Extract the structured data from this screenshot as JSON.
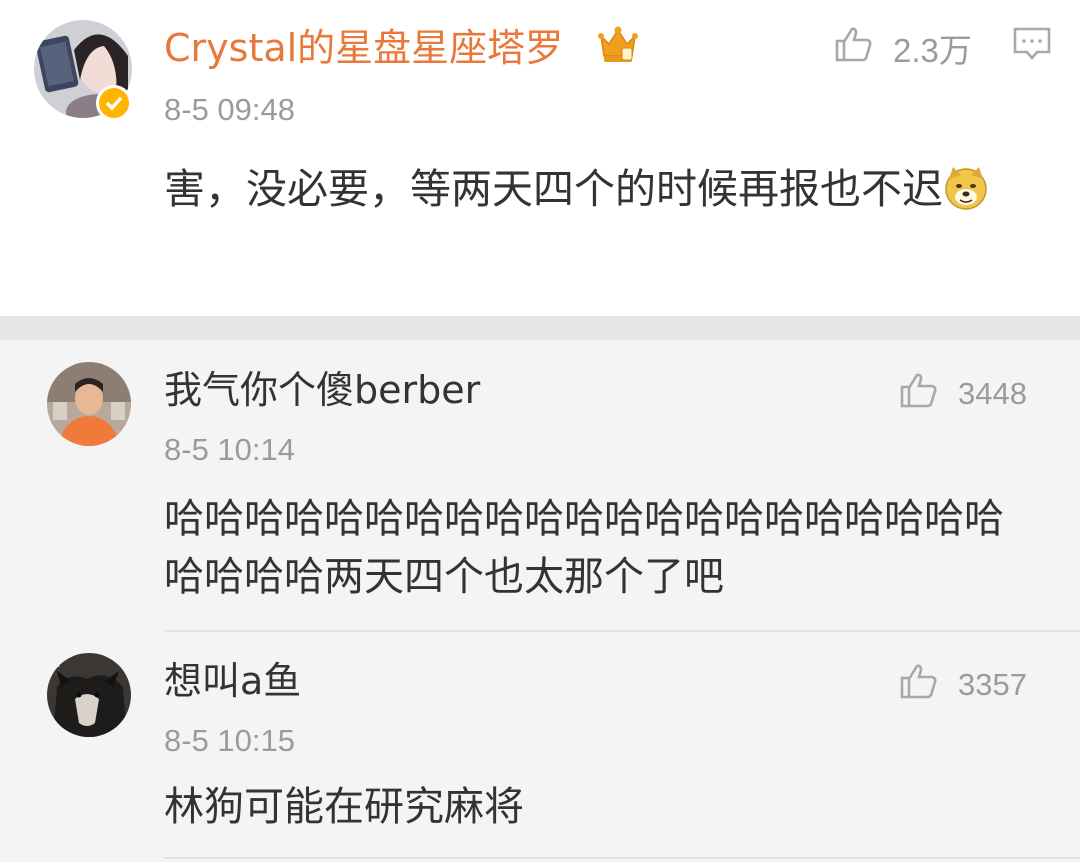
{
  "main_comment": {
    "username": "Crystal的星盘星座塔罗",
    "timestamp": "8-5 09:48",
    "likes": "2.3万",
    "text": "害，没必要，等两天四个的时候再报也不迟",
    "name_color": "#e8793a"
  },
  "replies": [
    {
      "username": "我气你个傻berber",
      "timestamp": "8-5 10:14",
      "likes": "3448",
      "text": "哈哈哈哈哈哈哈哈哈哈哈哈哈哈哈哈哈哈哈哈哈哈哈哈哈两天四个也太那个了吧"
    },
    {
      "username": "想叫a鱼",
      "timestamp": "8-5 10:15",
      "likes": "3357",
      "text": "林狗可能在研究麻将"
    }
  ],
  "icons": {
    "like": "thumbs-up-icon",
    "reply": "comment-icon",
    "badge": "crown-icon",
    "verified": "verified-badge-icon",
    "emoji": "doge-emoji"
  }
}
